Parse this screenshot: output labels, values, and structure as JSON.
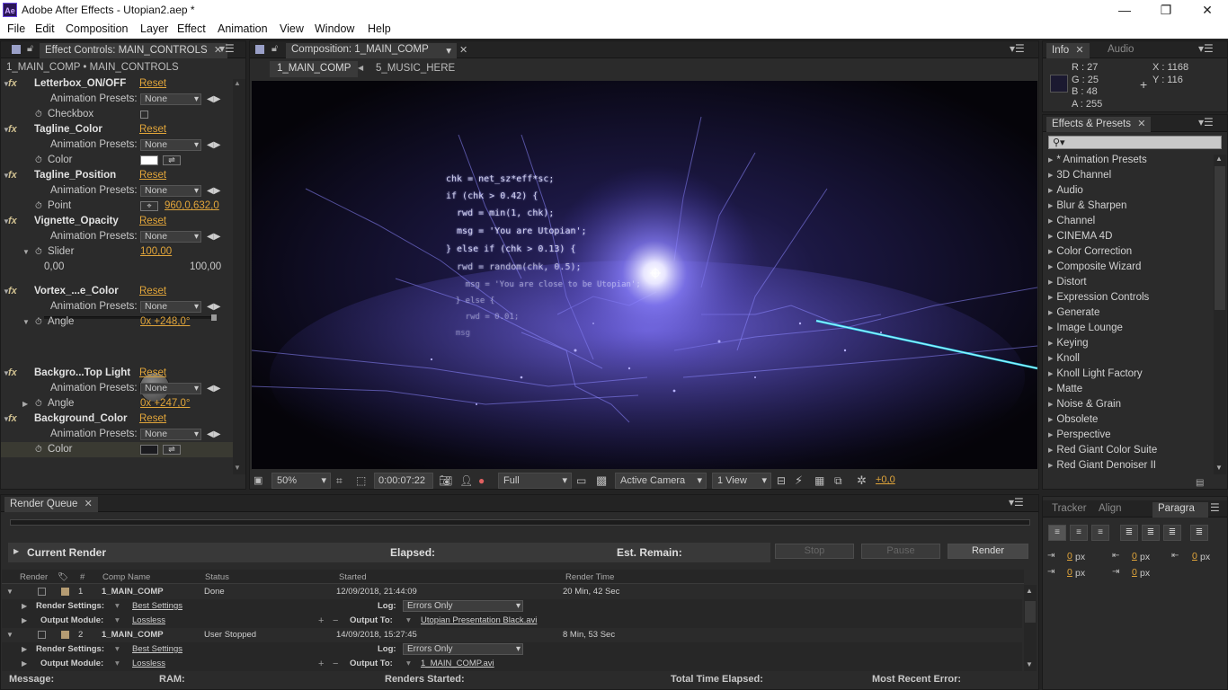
{
  "window": {
    "title": "Adobe After Effects - Utopian2.aep *",
    "app_icon": "Ae"
  },
  "menu": [
    "File",
    "Edit",
    "Composition",
    "Layer",
    "Effect",
    "Animation",
    "View",
    "Window",
    "Help"
  ],
  "effect_controls": {
    "tab": "Effect Controls: MAIN_CONTROLS",
    "breadcrumb": "1_MAIN_COMP • MAIN_CONTROLS",
    "reset": "Reset",
    "presets_label": "Animation Presets:",
    "preset_value": "None",
    "effects": [
      {
        "name": "Letterbox_ON/OFF",
        "param": "Checkbox"
      },
      {
        "name": "Tagline_Color",
        "param": "Color",
        "color": "#ffffff"
      },
      {
        "name": "Tagline_Position",
        "param": "Point",
        "value": "960,0,632,0"
      },
      {
        "name": "Vignette_Opacity",
        "param": "Slider",
        "value": "100,00",
        "min": "0,00",
        "max": "100,00",
        "level": 1.0
      },
      {
        "name": "Vortex_...e_Color",
        "param": "Angle",
        "value": "0x +248,0°"
      },
      {
        "name": "Backgro...Top Light",
        "param": "Angle",
        "value": "0x +247,0°"
      },
      {
        "name": "Background_Color",
        "param": "Color",
        "color": "#1b1b1f"
      }
    ]
  },
  "composition": {
    "tab": "Composition: 1_MAIN_COMP",
    "flow": [
      "1_MAIN_COMP",
      "5_MUSIC_HERE"
    ],
    "zoom": "50%",
    "timecode": "0:00:07:22",
    "resolution": "Full",
    "camera": "Active Camera",
    "views": "1 View",
    "exposure": "+0,0",
    "code_lines": [
      "chk = net_sz*eff*sc;",
      "if (chk > 0.42) {",
      "  rwd = min(1, chk);",
      "  msg = 'You are Utopian';",
      "} else if (chk > 0.13) {",
      "  rwd = random(chk, 0.5);",
      "    msg = 'You are close to be Utopian';",
      "  } else {",
      "    rwd = 0.01;",
      "  msg"
    ]
  },
  "info": {
    "tabs": [
      "Info",
      "Audio"
    ],
    "r": "R : 27",
    "g": "G : 25",
    "b": "B : 48",
    "a": "A : 255",
    "x": "X : 1168",
    "y": "Y : 116",
    "swatch": "#1b1930"
  },
  "effects_presets": {
    "tab": "Effects & Presets",
    "items": [
      "* Animation Presets",
      "3D Channel",
      "Audio",
      "Blur & Sharpen",
      "Channel",
      "CINEMA 4D",
      "Color Correction",
      "Composite Wizard",
      "Distort",
      "Expression Controls",
      "Generate",
      "Image Lounge",
      "Keying",
      "Knoll",
      "Knoll Light Factory",
      "Matte",
      "Noise & Grain",
      "Obsolete",
      "Perspective",
      "Red Giant Color Suite",
      "Red Giant Denoiser II"
    ]
  },
  "paragraph": {
    "tabs": [
      "Tracker",
      "Align",
      "Paragra"
    ],
    "value": "0",
    "unit": "px"
  },
  "render_queue": {
    "tab": "Render Queue",
    "current_render": "Current Render",
    "elapsed": "Elapsed:",
    "est_remain": "Est. Remain:",
    "buttons": {
      "stop": "Stop",
      "pause": "Pause",
      "render": "Render"
    },
    "columns": [
      "Render",
      "#",
      "Comp Name",
      "Status",
      "Started",
      "Render Time"
    ],
    "labels": {
      "render_settings": "Render Settings:",
      "output_module": "Output Module:",
      "log": "Log:",
      "output_to": "Output To:"
    },
    "items": [
      {
        "num": "1",
        "comp": "1_MAIN_COMP",
        "status": "Done",
        "started": "12/09/2018, 21:44:09",
        "time": "20 Min, 42 Sec",
        "settings": "Best Settings",
        "module": "Lossless",
        "log": "Errors Only",
        "output": "Utopian Presentation Black.avi"
      },
      {
        "num": "2",
        "comp": "1_MAIN_COMP",
        "status": "User Stopped",
        "started": "14/09/2018, 15:27:45",
        "time": "8 Min, 53 Sec",
        "settings": "Best Settings",
        "module": "Lossless",
        "log": "Errors Only",
        "output": "1_MAIN_COMP.avi"
      }
    ],
    "status_bar": {
      "message": "Message:",
      "ram": "RAM:",
      "renders_started": "Renders Started:",
      "total_time": "Total Time Elapsed:",
      "recent_error": "Most Recent Error:"
    }
  },
  "colors": {
    "accent_link": "#e1a53a",
    "panel_bg": "#2b2b2b",
    "viewer_glow": "#7b6cff",
    "laser": "#2ee6ff"
  }
}
